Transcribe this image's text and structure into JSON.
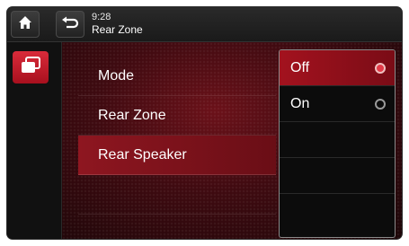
{
  "header": {
    "time": "9:28",
    "title": "Rear Zone",
    "home_icon": "home-icon",
    "back_icon": "back-icon"
  },
  "sidebar": {
    "icon": "windows-icon"
  },
  "menu": {
    "items": [
      {
        "label": "Mode"
      },
      {
        "label": "Rear Zone"
      },
      {
        "label": "Rear Speaker",
        "selected": true
      },
      {
        "label": ""
      }
    ]
  },
  "dropdown": {
    "options": [
      {
        "label": "Off",
        "selected": true
      },
      {
        "label": "On",
        "selected": false
      }
    ]
  },
  "colors": {
    "accent": "#a3121e",
    "background": "#3e0a10"
  }
}
